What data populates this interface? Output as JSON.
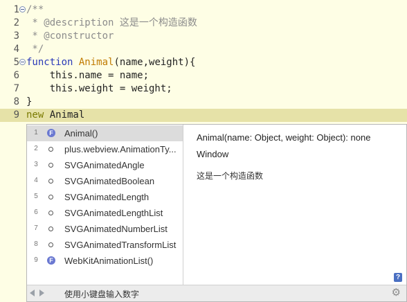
{
  "editor": {
    "lines": [
      {
        "num": "1",
        "fold": true,
        "parts": [
          {
            "cls": "c-comment",
            "text": "/**"
          }
        ]
      },
      {
        "num": "2",
        "fold": false,
        "parts": [
          {
            "cls": "c-comment",
            "text": " * @description 这是一个构造函数"
          }
        ]
      },
      {
        "num": "3",
        "fold": false,
        "parts": [
          {
            "cls": "c-comment",
            "text": " * @constructor"
          }
        ]
      },
      {
        "num": "4",
        "fold": false,
        "parts": [
          {
            "cls": "c-comment",
            "text": " */"
          }
        ]
      },
      {
        "num": "5",
        "fold": true,
        "parts": [
          {
            "cls": "c-kw",
            "text": "function "
          },
          {
            "cls": "c-fn",
            "text": "Animal"
          },
          {
            "cls": "c-id",
            "text": "(name,weight){"
          }
        ]
      },
      {
        "num": "6",
        "fold": false,
        "parts": [
          {
            "cls": "c-id",
            "text": "    this.name = name;"
          }
        ]
      },
      {
        "num": "7",
        "fold": false,
        "parts": [
          {
            "cls": "c-id",
            "text": "    this.weight = weight;"
          }
        ]
      },
      {
        "num": "8",
        "fold": false,
        "parts": [
          {
            "cls": "c-id",
            "text": "}"
          }
        ]
      },
      {
        "num": "9",
        "fold": false,
        "current": true,
        "parts": [
          {
            "cls": "c-new",
            "text": "new "
          },
          {
            "cls": "c-id",
            "text": "Animal"
          }
        ]
      }
    ]
  },
  "completion": {
    "items": [
      {
        "index": "1",
        "icon": "function-icon",
        "label": "Animal()",
        "selected": true
      },
      {
        "index": "2",
        "icon": "object-icon",
        "label": "plus.webview.AnimationTy..."
      },
      {
        "index": "3",
        "icon": "object-icon",
        "label": "SVGAnimatedAngle"
      },
      {
        "index": "4",
        "icon": "object-icon",
        "label": "SVGAnimatedBoolean"
      },
      {
        "index": "5",
        "icon": "object-icon",
        "label": "SVGAnimatedLength"
      },
      {
        "index": "6",
        "icon": "object-icon",
        "label": "SVGAnimatedLengthList"
      },
      {
        "index": "7",
        "icon": "object-icon",
        "label": "SVGAnimatedNumberList"
      },
      {
        "index": "8",
        "icon": "object-icon",
        "label": "SVGAnimatedTransformList"
      },
      {
        "index": "9",
        "icon": "function-icon",
        "label": "WebKitAnimationList()"
      }
    ],
    "function_icon_glyph": "F",
    "doc": {
      "signature": "Animal(name: Object, weight: Object): none",
      "owner": "Window",
      "description": "这是一个构造函数"
    },
    "help_glyph": "?",
    "footer": {
      "hint": "使用小键盘输入数字",
      "settings_icon": "gear-icon",
      "settings_glyph": "⚙"
    }
  },
  "colors": {
    "editor_bg": "#fefee5",
    "current_line": "#e6e2a8",
    "keyword": "#2a39b8",
    "function_name": "#c07a00",
    "comment": "#8c8c8c",
    "selection": "#dcdcdc"
  }
}
